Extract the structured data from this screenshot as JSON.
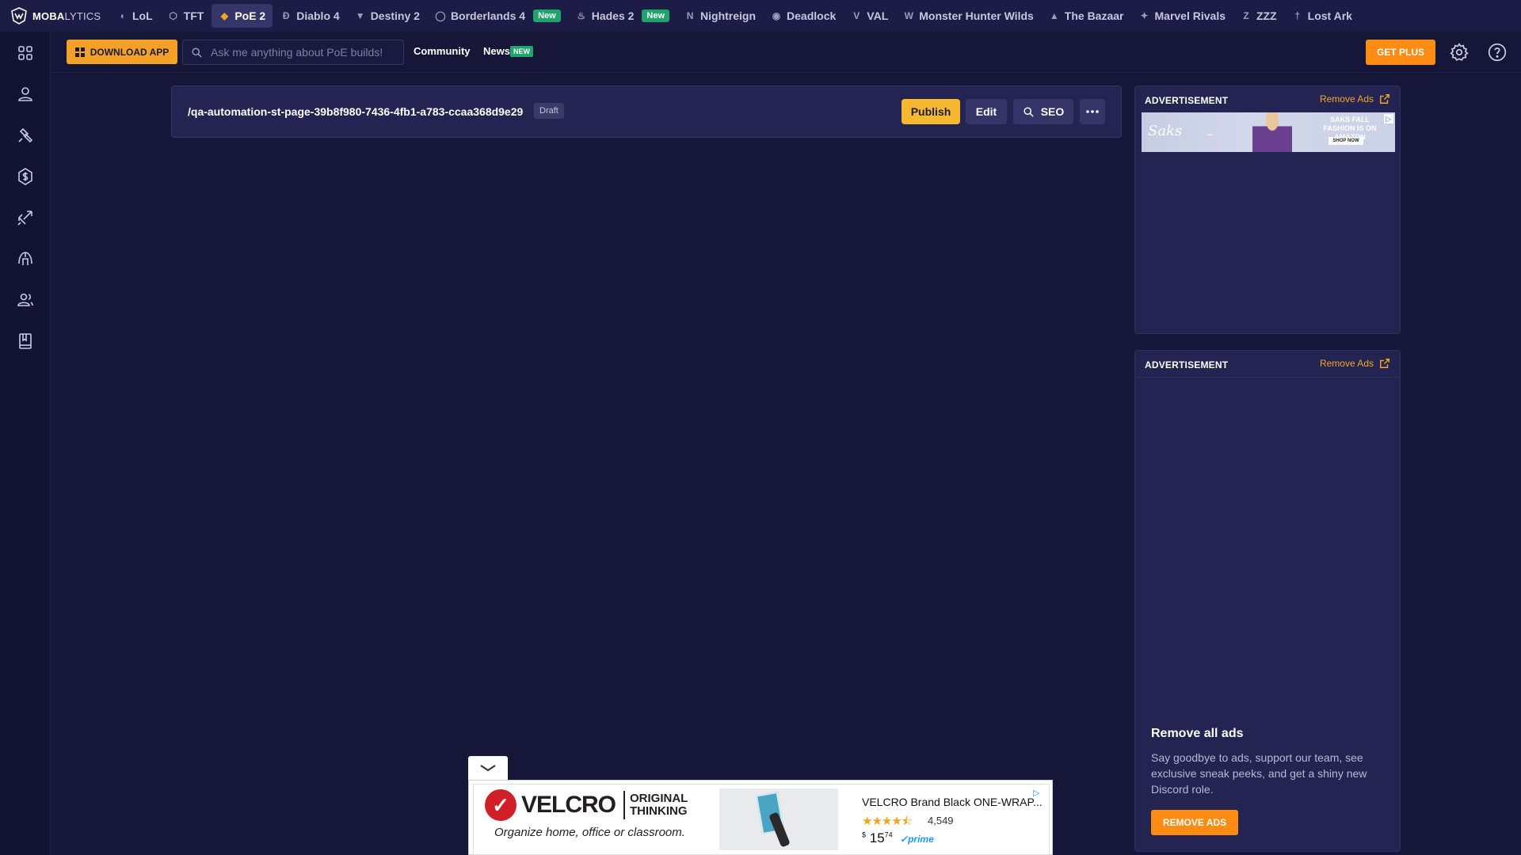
{
  "brand": {
    "logo_main": "MOBA",
    "logo_light": "LYTICS"
  },
  "games": [
    {
      "icon": "lol-icon",
      "glyph": "◖",
      "label": "LoL",
      "active": false,
      "new": false
    },
    {
      "icon": "tft-icon",
      "glyph": "⬡",
      "label": "TFT",
      "active": false,
      "new": false
    },
    {
      "icon": "poe2-icon",
      "glyph": "◆",
      "label": "PoE 2",
      "active": true,
      "new": false
    },
    {
      "icon": "diablo4-icon",
      "glyph": "Ɖ",
      "label": "Diablo 4",
      "active": false,
      "new": false
    },
    {
      "icon": "destiny2-icon",
      "glyph": "▼",
      "label": "Destiny 2",
      "active": false,
      "new": false
    },
    {
      "icon": "borderlands4-icon",
      "glyph": "◯",
      "label": "Borderlands 4",
      "active": false,
      "new": true
    },
    {
      "icon": "hades2-icon",
      "glyph": "♨",
      "label": "Hades 2",
      "active": false,
      "new": true
    },
    {
      "icon": "nightreign-icon",
      "glyph": "N",
      "label": "Nightreign",
      "active": false,
      "new": false
    },
    {
      "icon": "deadlock-icon",
      "glyph": "◉",
      "label": "Deadlock",
      "active": false,
      "new": false
    },
    {
      "icon": "val-icon",
      "glyph": "V",
      "label": "VAL",
      "active": false,
      "new": false
    },
    {
      "icon": "monster-hunter-wilds-icon",
      "glyph": "W",
      "label": "Monster Hunter Wilds",
      "active": false,
      "new": false
    },
    {
      "icon": "the-bazaar-icon",
      "glyph": "▲",
      "label": "The Bazaar",
      "active": false,
      "new": false
    },
    {
      "icon": "marvel-rivals-icon",
      "glyph": "✦",
      "label": "Marvel Rivals",
      "active": false,
      "new": false
    },
    {
      "icon": "zzz-icon",
      "glyph": "Z",
      "label": "ZZZ",
      "active": false,
      "new": false
    },
    {
      "icon": "lost-ark-icon",
      "glyph": "†",
      "label": "Lost Ark",
      "active": false,
      "new": false
    }
  ],
  "new_badge": "New",
  "rail": [
    "grid-icon",
    "user-icon",
    "hammer-icon",
    "currency-icon",
    "item-icon",
    "helmet-icon",
    "community-icon",
    "bookmark-icon"
  ],
  "header": {
    "download_label": "DOWNLOAD APP",
    "search_placeholder": "Ask me anything about PoE builds!",
    "community_label": "Community",
    "news_label": "News",
    "news_badge": "NEW",
    "get_plus_label": "GET PLUS"
  },
  "page": {
    "slug": "/qa-automation-st-page-39b8f980-7436-4fb1-a783-ccaa368d9e29",
    "status": "Draft",
    "publish_label": "Publish",
    "edit_label": "Edit",
    "seo_label": "SEO"
  },
  "ads": {
    "heading": "ADVERTISEMENT",
    "remove_link": "Remove Ads",
    "saks_brand": "Saks",
    "saks_tagline": "SAKS FALL FASHION IS ON AMAZON",
    "saks_cta": "SHOP NOW",
    "remove_title": "Remove all ads",
    "remove_desc": "Say goodbye to ads, support our team, see exclusive sneak peeks, and get a shiny new Discord role.",
    "remove_button": "REMOVE ADS"
  },
  "sticky_ad": {
    "brand": "VELCRO",
    "tagline_1": "ORIGINAL",
    "tagline_2": "THINKING",
    "slogan": "Organize home, office or classroom.",
    "product_title": "VELCRO Brand Black ONE-WRAP...",
    "rating": 4.5,
    "rating_count": "4,549",
    "price_dollars": "15",
    "price_cents": "74",
    "prime": "prime"
  },
  "colors": {
    "accent": "#f5a623",
    "bg": "#161639",
    "panel": "#242452",
    "new_badge": "#1fa46b",
    "plus": "#ff8c12"
  }
}
